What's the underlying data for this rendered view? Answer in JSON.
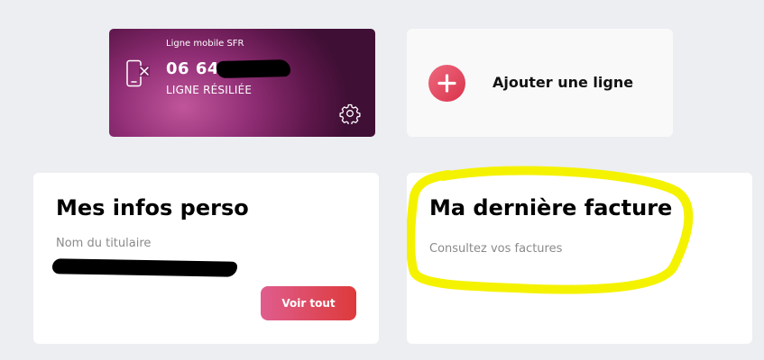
{
  "line_card": {
    "label": "Ligne mobile SFR",
    "number_prefix": "06 64",
    "status": "LIGNE RÉSILIÉE"
  },
  "add_line": {
    "label": "Ajouter une ligne"
  },
  "infos": {
    "title": "Mes infos perso",
    "field_label": "Nom du titulaire",
    "button_label": "Voir tout"
  },
  "facture": {
    "title": "Ma dernière facture",
    "subtitle": "Consultez vos factures"
  },
  "colors": {
    "page_bg": "#eceef1",
    "line_card_purple": "#8f2d74",
    "accent_red": "#d9334b",
    "highlight_yellow": "#f5f200"
  },
  "icons": [
    "phone-disconnected-icon",
    "gear-icon",
    "plus-icon"
  ]
}
